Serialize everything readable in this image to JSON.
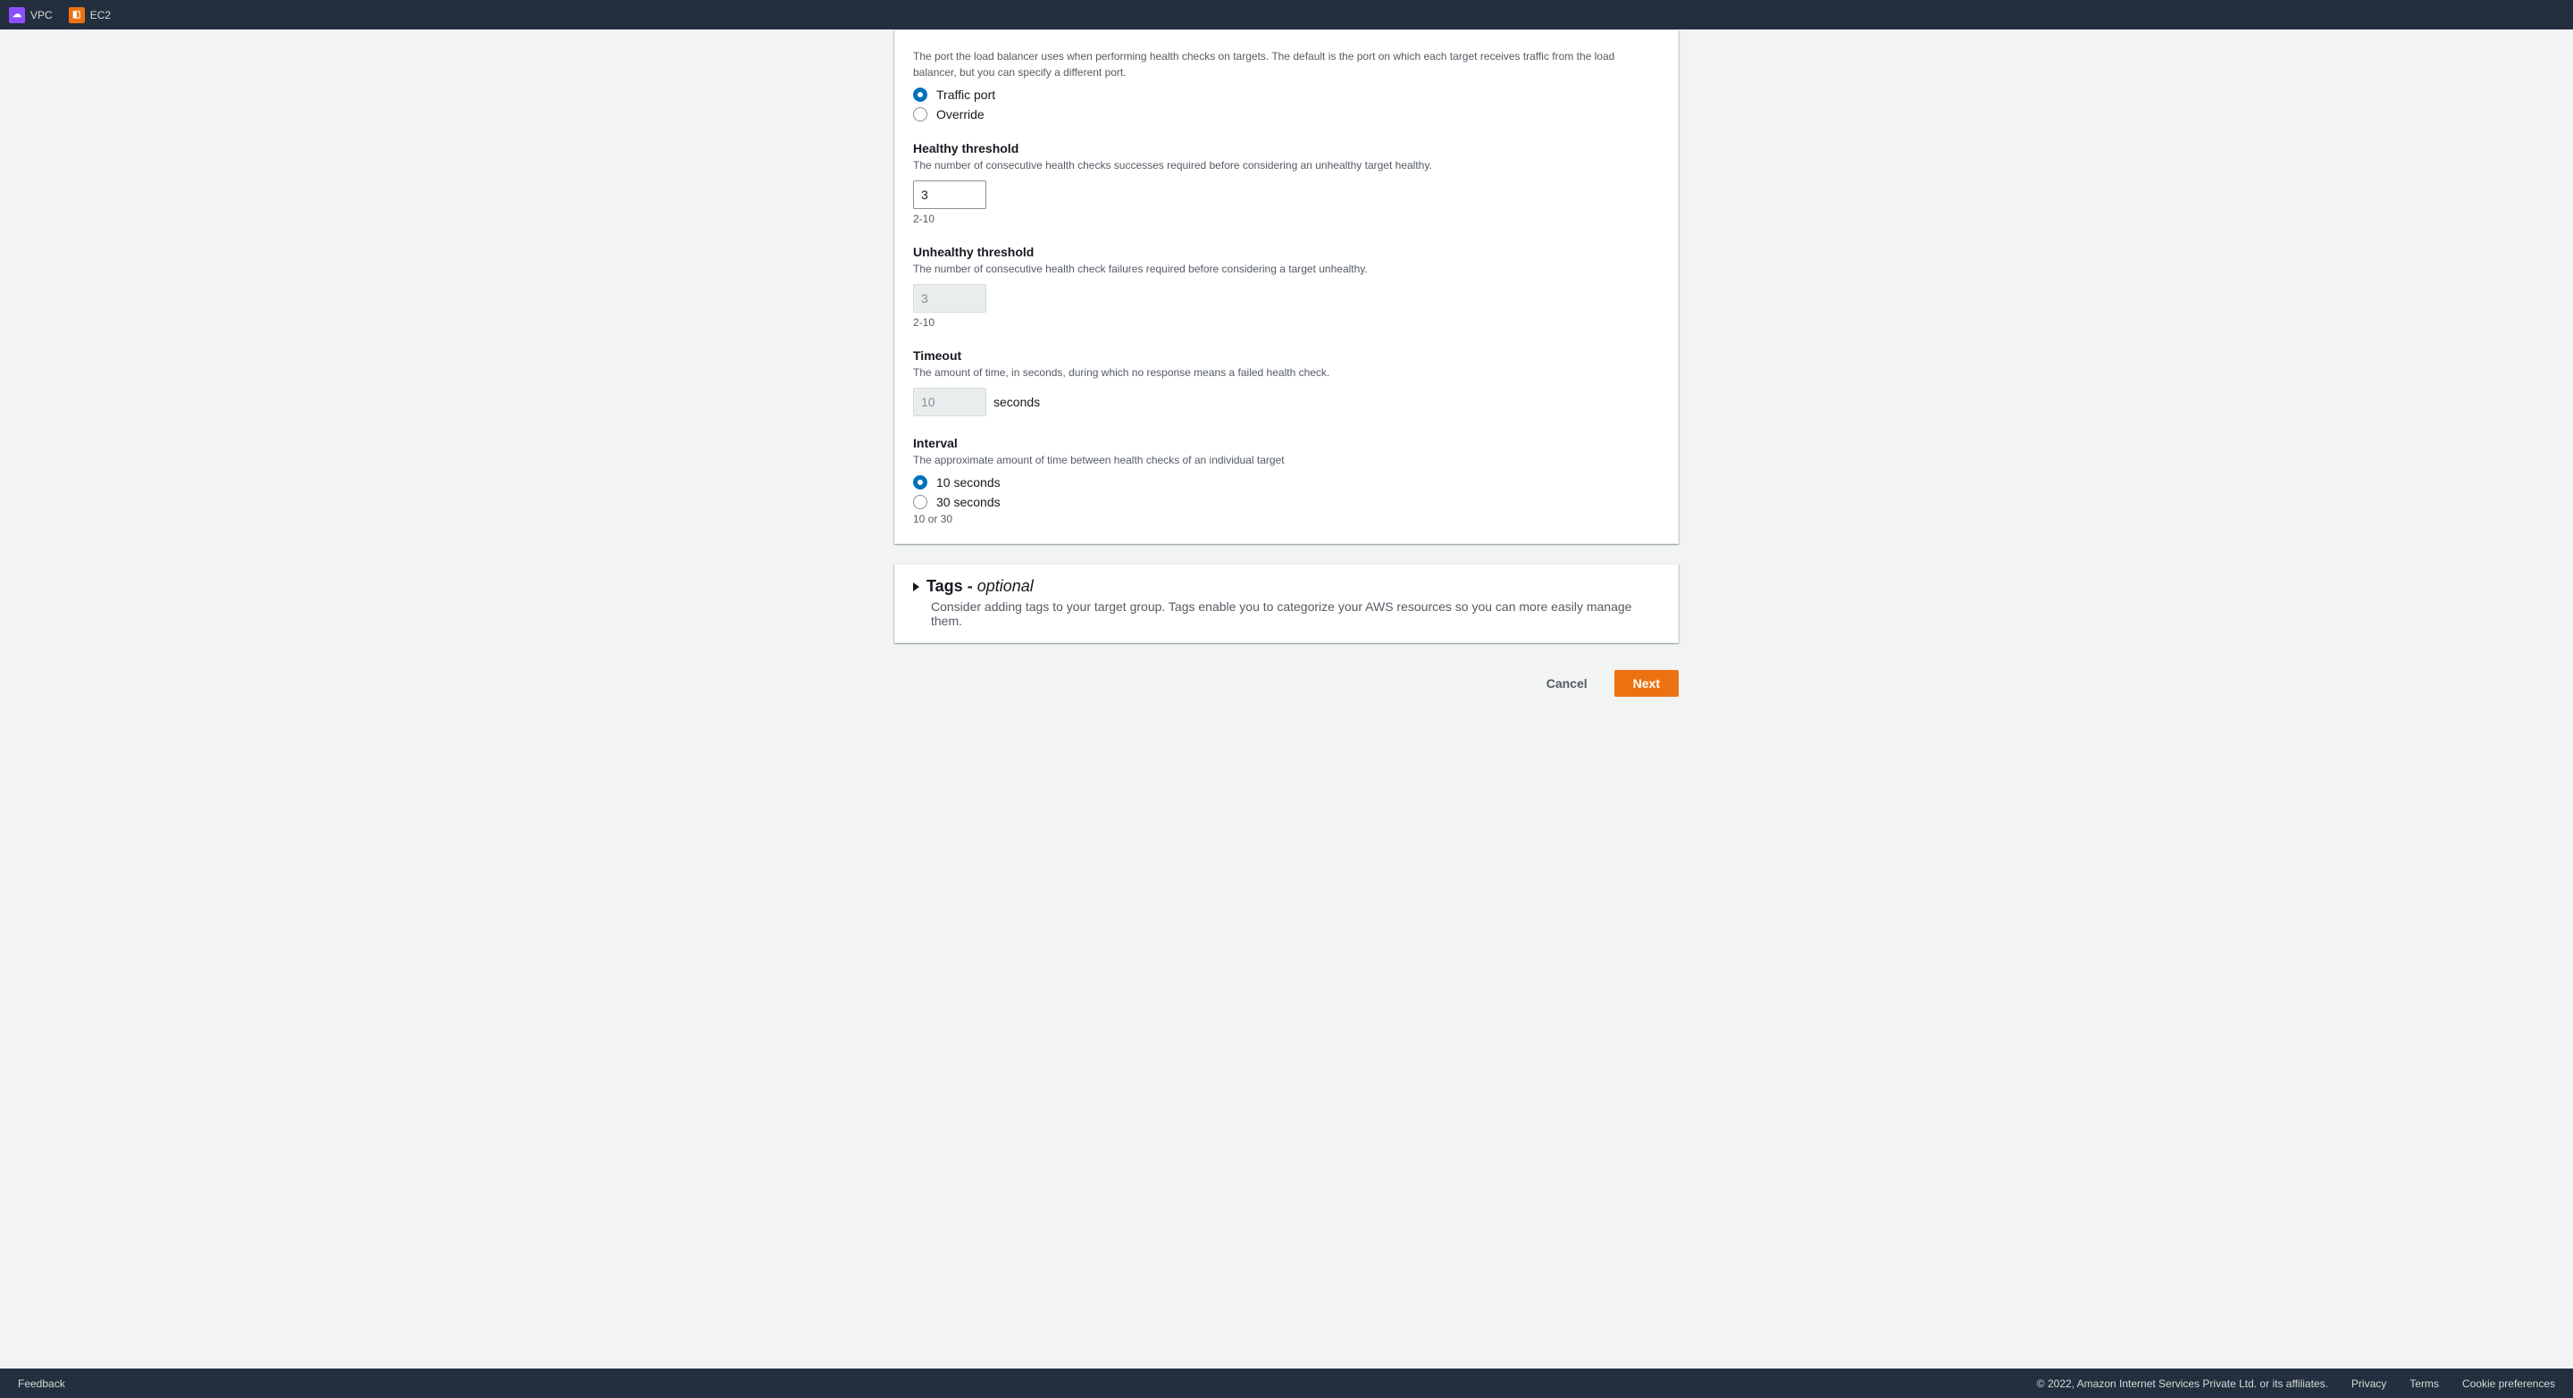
{
  "nav": {
    "items": [
      {
        "label": "VPC",
        "icon": "vpc"
      },
      {
        "label": "EC2",
        "icon": "ec2"
      }
    ]
  },
  "form": {
    "port": {
      "desc": "The port the load balancer uses when performing health checks on targets. The default is the port on which each target receives traffic from the load balancer, but you can specify a different port.",
      "options": {
        "traffic": "Traffic port",
        "override": "Override"
      }
    },
    "healthyThreshold": {
      "label": "Healthy threshold",
      "desc": "The number of consecutive health checks successes required before considering an unhealthy target healthy.",
      "value": "3",
      "hint": "2-10"
    },
    "unhealthyThreshold": {
      "label": "Unhealthy threshold",
      "desc": "The number of consecutive health check failures required before considering a target unhealthy.",
      "value": "3",
      "hint": "2-10"
    },
    "timeout": {
      "label": "Timeout",
      "desc": "The amount of time, in seconds, during which no response means a failed health check.",
      "value": "10",
      "unit": "seconds"
    },
    "interval": {
      "label": "Interval",
      "desc": "The approximate amount of time between health checks of an individual target",
      "options": {
        "ten": "10 seconds",
        "thirty": "30 seconds"
      },
      "hint": "10 or 30"
    }
  },
  "tags": {
    "title": "Tags",
    "dash": " - ",
    "optional": "optional",
    "desc": "Consider adding tags to your target group. Tags enable you to categorize your AWS resources so you can more easily manage them."
  },
  "buttons": {
    "cancel": "Cancel",
    "next": "Next"
  },
  "footer": {
    "feedback": "Feedback",
    "copyright": "© 2022, Amazon Internet Services Private Ltd. or its affiliates.",
    "privacy": "Privacy",
    "terms": "Terms",
    "cookie": "Cookie preferences"
  }
}
